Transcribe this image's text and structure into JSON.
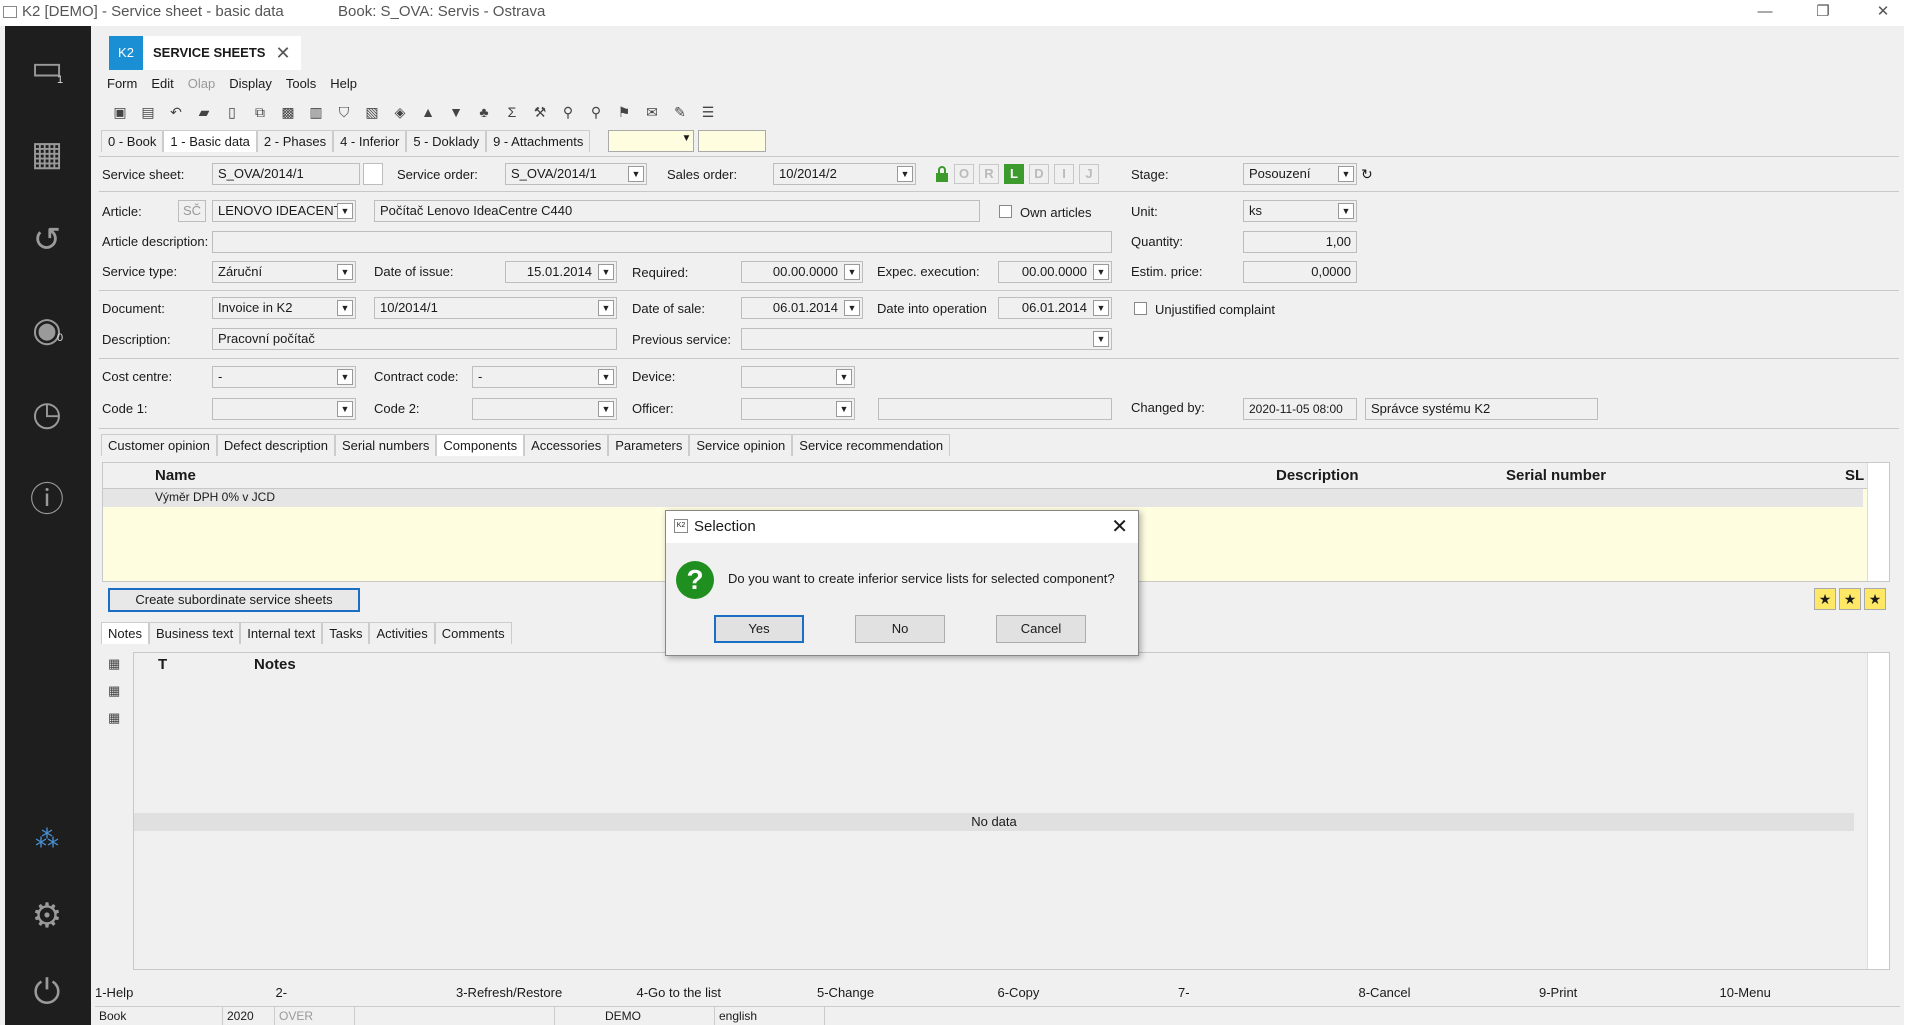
{
  "window": {
    "title": "K2 [DEMO] - Service sheet - basic data",
    "book": "Book: S_OVA: Servis - Ostrava"
  },
  "sidebar": {
    "badge_1": "1",
    "badge_2": "0"
  },
  "doc_tab": {
    "tag": "K2",
    "label": "SERVICE SHEETS"
  },
  "menu": [
    "Form",
    "Edit",
    "Olap",
    "Display",
    "Tools",
    "Help"
  ],
  "page_tabs": [
    "0 - Book",
    "1 - Basic data",
    "2 - Phases",
    "4 - Inferior",
    "5 - Doklady",
    "9 - Attachments"
  ],
  "form": {
    "service_sheet_label": "Service sheet:",
    "service_sheet": "S_OVA/2014/1",
    "service_order_label": "Service order:",
    "service_order": "S_OVA/2014/1",
    "sales_order_label": "Sales order:",
    "sales_order": "10/2014/2",
    "stage_label": "Stage:",
    "stage": "Posouzení",
    "letters": [
      "O",
      "R",
      "L",
      "D",
      "I",
      "J"
    ],
    "article_label": "Article:",
    "article_code": "SČ",
    "article": "LENOVO IDEACENT",
    "article_name": "Počítač Lenovo IdeaCentre C440",
    "own_articles": "Own articles",
    "unit_label": "Unit:",
    "unit": "ks",
    "article_desc_label": "Article description:",
    "quantity_label": "Quantity:",
    "quantity": "1,00",
    "service_type_label": "Service type:",
    "service_type": "Záruční",
    "date_issue_label": "Date of issue:",
    "date_issue": "15.01.2014",
    "required_label": "Required:",
    "required": "00.00.0000",
    "expec_label": "Expec. execution:",
    "expec": "00.00.0000",
    "estim_label": "Estim. price:",
    "estim": "0,0000",
    "document_label": "Document:",
    "document": "Invoice in K2",
    "document_no": "10/2014/1",
    "date_sale_label": "Date of sale:",
    "date_sale": "06.01.2014",
    "date_op_label": "Date into operation",
    "date_op": "06.01.2014",
    "unjustified": "Unjustified complaint",
    "description_label": "Description:",
    "description": "Pracovní počítač",
    "prev_service_label": "Previous service:",
    "cost_centre_label": "Cost centre:",
    "cost_centre": "-",
    "contract_label": "Contract code:",
    "contract": "-",
    "device_label": "Device:",
    "code1_label": "Code 1:",
    "code2_label": "Code 2:",
    "officer_label": "Officer:",
    "changed_by_label": "Changed by:",
    "changed_at": "2020-11-05 08:00",
    "changed_by": "Správce systému K2"
  },
  "detail_tabs": [
    "Customer opinion",
    "Defect description",
    "Serial numbers",
    "Components",
    "Accessories",
    "Parameters",
    "Service opinion",
    "Service recommendation"
  ],
  "components": {
    "columns": [
      "Name",
      "Description",
      "Serial number",
      "SL"
    ],
    "rows": [
      {
        "name": "Výměr DPH  0% v JCD"
      }
    ]
  },
  "create_button": "Create subordinate service sheets",
  "notes_tabs": [
    "Notes",
    "Business text",
    "Internal text",
    "Tasks",
    "Activities",
    "Comments"
  ],
  "notes": {
    "col_t": "T",
    "col_notes": "Notes",
    "no_data": "No data"
  },
  "fkeys": [
    "1-Help",
    "2-",
    "3-Refresh/Restore",
    "4-Go to the list",
    "5-Change",
    "6-Copy",
    "7-",
    "8-Cancel",
    "9-Print",
    "10-Menu"
  ],
  "status": [
    "Book",
    "2020",
    "OVER",
    "",
    "DEMO",
    "english"
  ],
  "dialog": {
    "title": "Selection",
    "message": "Do you want to create inferior service lists for selected component?",
    "yes": "Yes",
    "no": "No",
    "cancel": "Cancel"
  }
}
